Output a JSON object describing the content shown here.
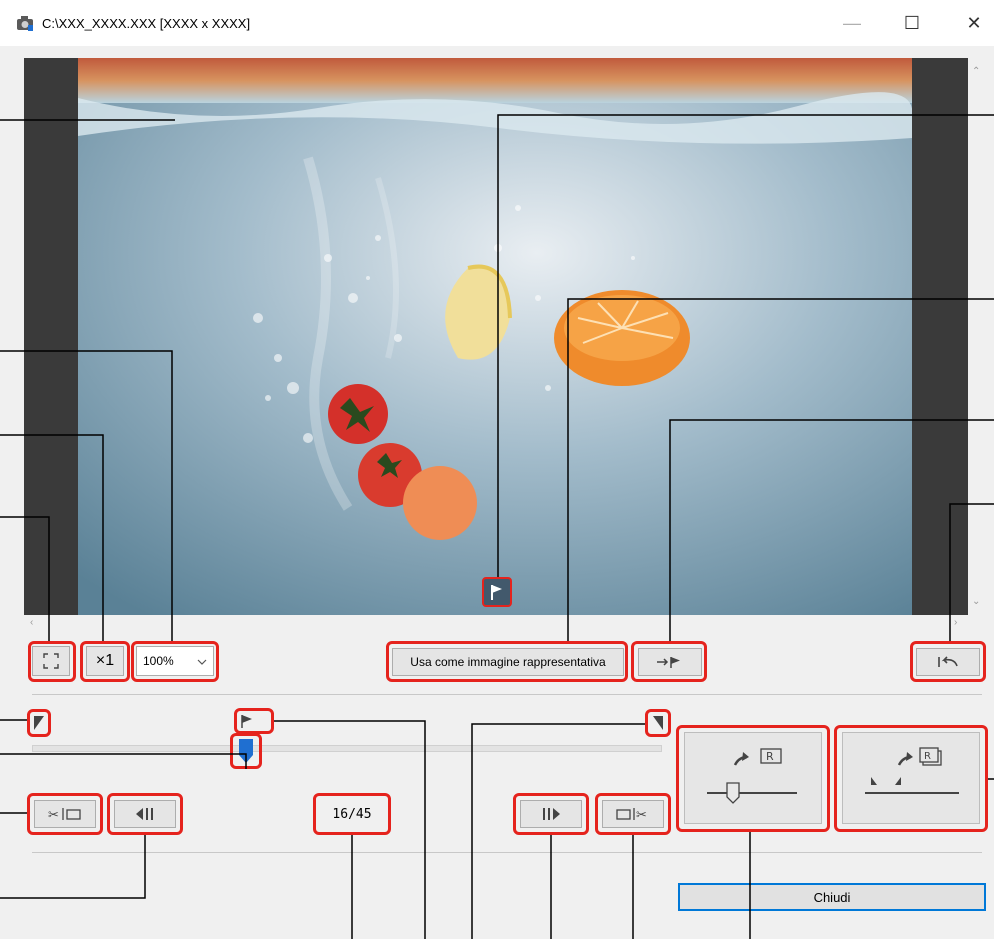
{
  "window": {
    "title": "C:\\XXX_XXXX.XXX [XXXX x XXXX]",
    "minimize_glyph": "—",
    "maximize_glyph": "☐",
    "close_glyph": "✕"
  },
  "toolbar": {
    "zoom_value": "100%",
    "x1_label": "×1",
    "representative_label": "Usa come immagine rappresentativa"
  },
  "playback": {
    "frame_counter": "16/45"
  },
  "footer": {
    "close_label": "Chiudi"
  },
  "colors": {
    "highlight": "#e5231d",
    "accent": "#0078d7",
    "slider_knob": "#1f6fd1",
    "flag_bg": "#42596c"
  },
  "icons": {
    "app": "camera-app-icon",
    "fit": "fit-to-window-icon",
    "x1": "actual-size-icon",
    "goto_frame": "go-to-representative-frame-icon",
    "restore": "return-icon",
    "trim_start": "trim-start-icon",
    "prev_frame": "previous-frame-icon",
    "next_frame": "next-frame-icon",
    "trim_end": "trim-end-icon",
    "save_frame": "save-current-frame-icon",
    "save_all": "save-all-frames-icon"
  }
}
